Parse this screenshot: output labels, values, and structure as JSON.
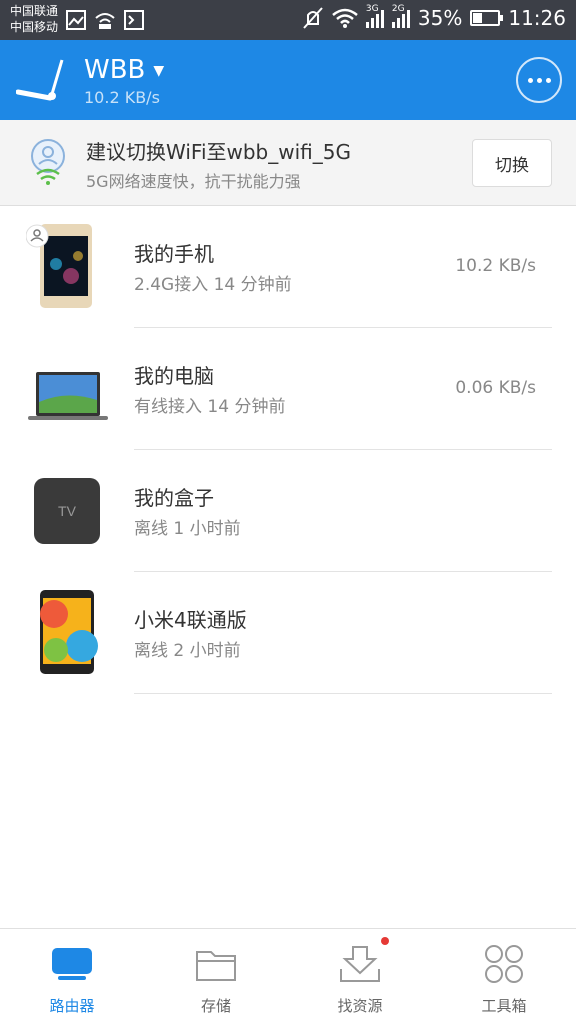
{
  "status_bar": {
    "carrier_1": "中国联通",
    "carrier_2": "中国移动",
    "network_tags": [
      "3G",
      "2G"
    ],
    "battery": "35%",
    "battery_level": 0.35,
    "time": "11:26"
  },
  "header": {
    "title": "WBB",
    "speed": "10.2 KB/s"
  },
  "banner": {
    "title": "建议切换WiFi至wbb_wifi_5G",
    "subtitle": "5G网络速度快，抗干扰能力强",
    "button_label": "切换"
  },
  "devices": [
    {
      "name": "我的手机",
      "meta": "2.4G接入   14 分钟前",
      "speed": "10.2 KB/s",
      "icon": "phone-icon"
    },
    {
      "name": "我的电脑",
      "meta": "有线接入   14 分钟前",
      "speed": "0.06 KB/s",
      "icon": "laptop-icon"
    },
    {
      "name": "我的盒子",
      "meta": "离线   1 小时前",
      "speed": "",
      "icon": "tv-box-icon",
      "thumb_label": "TV"
    },
    {
      "name": "小米4联通版",
      "meta": "离线   2 小时前",
      "speed": "",
      "icon": "phone-icon"
    }
  ],
  "nav": [
    {
      "label": "路由器",
      "icon": "router-icon",
      "active": true
    },
    {
      "label": "存储",
      "icon": "folder-icon",
      "active": false
    },
    {
      "label": "找资源",
      "icon": "download-icon",
      "active": false
    },
    {
      "label": "工具箱",
      "icon": "tools-icon",
      "active": false
    }
  ],
  "colors": {
    "accent": "#1e88e5",
    "status_bar": "#3c3f47",
    "banner_bg": "#f4f4f4",
    "badge_red": "#e53935"
  }
}
